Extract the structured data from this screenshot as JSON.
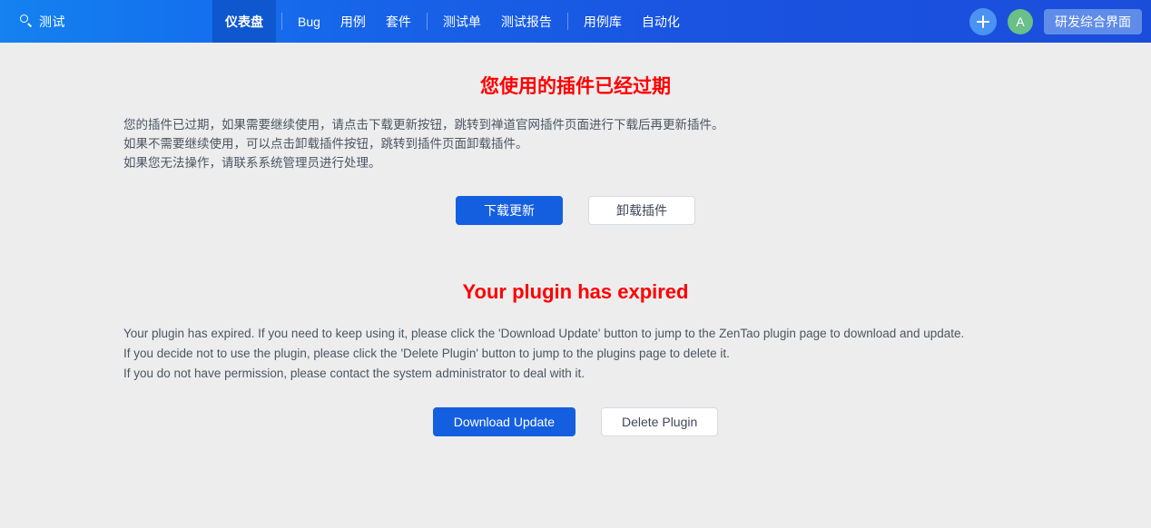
{
  "header": {
    "brand": {
      "icon": "search-icon",
      "label": "测试"
    },
    "nav": [
      {
        "label": "仪表盘",
        "active": true
      },
      {
        "label": "Bug",
        "active": false
      },
      {
        "label": "用例",
        "active": false
      },
      {
        "label": "套件",
        "active": false
      },
      {
        "label": "测试单",
        "active": false
      },
      {
        "label": "测试报告",
        "active": false
      },
      {
        "label": "用例库",
        "active": false
      },
      {
        "label": "自动化",
        "active": false
      }
    ],
    "actions": {
      "add_icon": "plus-icon",
      "avatar_initial": "A",
      "mode_button": "研发综合界面"
    },
    "colors": {
      "gradient_start": "#1482ef",
      "gradient_end": "#1b4ddb",
      "active_tab_bg": "#0f57cf",
      "avatar_bg": "#6bbf88",
      "add_button_bg": "#4a93f2",
      "mode_button_bg": "#5f8ce8"
    }
  },
  "page": {
    "background": "#ededed",
    "cn": {
      "title": "您使用的插件已经过期",
      "title_color": "#fd0000",
      "lines": [
        "您的插件已过期，如果需要继续使用，请点击下载更新按钮，跳转到禅道官网插件页面进行下载后再更新插件。",
        "如果不需要继续使用，可以点击卸载插件按钮，跳转到插件页面卸载插件。",
        "如果您无法操作，请联系系统管理员进行处理。"
      ],
      "primary_button": "下载更新",
      "secondary_button": "卸载插件"
    },
    "en": {
      "title": "Your plugin has expired",
      "title_color": "#fd0000",
      "lines": [
        "Your plugin has expired. If you need to keep using it, please click the 'Download Update' button to jump to the ZenTao plugin page to download and update.",
        "If you decide not to use the plugin, please click the 'Delete Plugin' button to jump to the plugins page to delete it.",
        "If you do not have permission, please contact the system administrator to deal with it."
      ],
      "primary_button": "Download Update",
      "secondary_button": "Delete Plugin"
    }
  }
}
